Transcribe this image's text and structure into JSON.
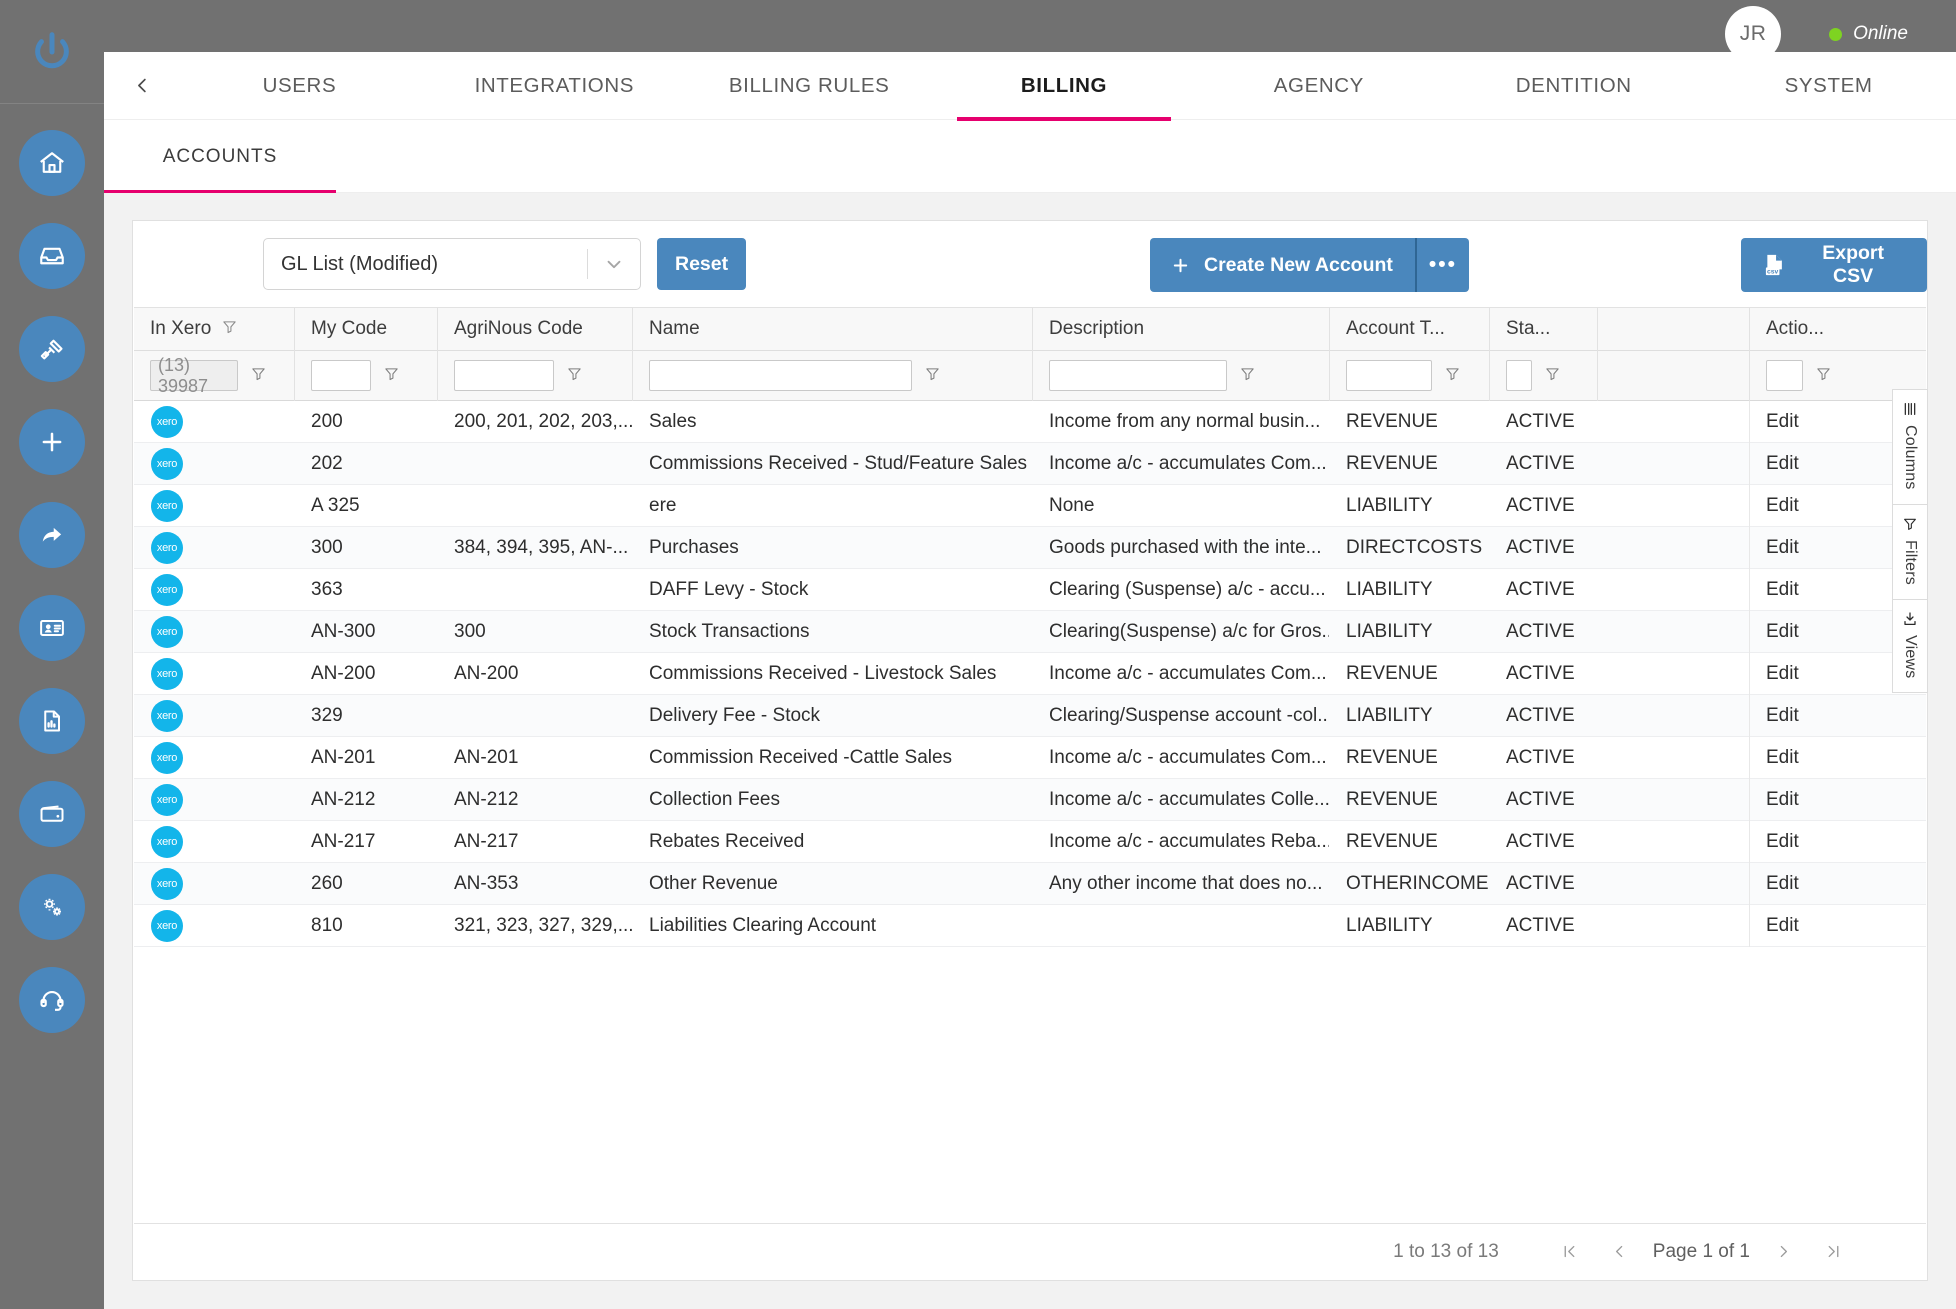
{
  "topbar": {
    "avatar_initials": "JR",
    "status_label": "Online",
    "status_color": "#7ed321"
  },
  "rail": {
    "logo_icon": "power-logo-icon",
    "items": [
      {
        "icon": "home-icon",
        "name": "home"
      },
      {
        "icon": "inbox-icon",
        "name": "inbox"
      },
      {
        "icon": "hammer-icon",
        "name": "auction"
      },
      {
        "icon": "plus-icon",
        "name": "create"
      },
      {
        "icon": "forward-icon",
        "name": "transfer"
      },
      {
        "icon": "contact-card-icon",
        "name": "contacts"
      },
      {
        "icon": "report-icon",
        "name": "reports"
      },
      {
        "icon": "wallet-icon",
        "name": "wallet"
      },
      {
        "icon": "gears-icon",
        "name": "settings"
      },
      {
        "icon": "headset-icon",
        "name": "support"
      }
    ]
  },
  "nav": {
    "back_icon": "chevron-left-icon",
    "tabs": [
      {
        "label": "USERS",
        "active": false
      },
      {
        "label": "INTEGRATIONS",
        "active": false
      },
      {
        "label": "BILLING RULES",
        "active": false
      },
      {
        "label": "BILLING",
        "active": true
      },
      {
        "label": "AGENCY",
        "active": false
      },
      {
        "label": "DENTITION",
        "active": false
      },
      {
        "label": "SYSTEM",
        "active": false
      }
    ],
    "subtabs": [
      {
        "label": "ACCOUNTS",
        "active": true
      }
    ],
    "accent_color": "#e6006e"
  },
  "toolbar": {
    "view_select_value": "GL List (Modified)",
    "view_select_caret_icon": "chevron-down-icon",
    "reset_label": "Reset",
    "create_label": "Create New Account",
    "create_plus_icon": "plus-icon",
    "create_more_label": "•••",
    "export_label": "Export CSV",
    "export_icon": "csv-file-icon",
    "primary_color": "#4a87bd"
  },
  "grid": {
    "columns": [
      {
        "key": "in_xero",
        "label": "In Xero",
        "has_filter_indicator": true,
        "filter_value": "(13) 39987",
        "filter_readonly": true,
        "input_width": 88
      },
      {
        "key": "my_code",
        "label": "My Code",
        "has_filter_indicator": false,
        "filter_value": "",
        "filter_readonly": false,
        "input_width": 60
      },
      {
        "key": "agrinous",
        "label": "AgriNous Code",
        "has_filter_indicator": false,
        "filter_value": "",
        "filter_readonly": false,
        "input_width": 100
      },
      {
        "key": "name",
        "label": "Name",
        "has_filter_indicator": false,
        "filter_value": "",
        "filter_readonly": false,
        "input_width": 263
      },
      {
        "key": "description",
        "label": "Description",
        "has_filter_indicator": false,
        "filter_value": "",
        "filter_readonly": false,
        "input_width": 178
      },
      {
        "key": "account_type",
        "label": "Account T...",
        "has_filter_indicator": false,
        "filter_value": "",
        "filter_readonly": false,
        "input_width": 86
      },
      {
        "key": "status",
        "label": "Sta...",
        "has_filter_indicator": false,
        "filter_value": "",
        "filter_readonly": false,
        "input_width": 26
      },
      {
        "key": "spacer",
        "label": "",
        "has_filter_indicator": false,
        "filter_value": null,
        "filter_readonly": false,
        "input_width": 0
      },
      {
        "key": "actions",
        "label": "Actio...",
        "has_filter_indicator": false,
        "filter_value": "",
        "filter_readonly": false,
        "input_width": 37
      }
    ],
    "xero_badge_label": "xero",
    "action_label": "Edit",
    "rows": [
      {
        "in_xero": true,
        "my_code": "200",
        "agrinous": "200, 201, 202, 203,...",
        "name": "Sales",
        "description": "Income from any normal busin...",
        "account_type": "REVENUE",
        "status": "ACTIVE"
      },
      {
        "in_xero": true,
        "my_code": "202",
        "agrinous": "",
        "name": "Commissions Received - Stud/Feature Sales",
        "description": "Income a/c - accumulates Com...",
        "account_type": "REVENUE",
        "status": "ACTIVE"
      },
      {
        "in_xero": true,
        "my_code": "A 325",
        "agrinous": "",
        "name": "ere",
        "description": "None",
        "account_type": "LIABILITY",
        "status": "ACTIVE"
      },
      {
        "in_xero": true,
        "my_code": "300",
        "agrinous": "384, 394, 395, AN-...",
        "name": "Purchases",
        "description": "Goods purchased with the inte...",
        "account_type": "DIRECTCOSTS",
        "status": "ACTIVE"
      },
      {
        "in_xero": true,
        "my_code": "363",
        "agrinous": "",
        "name": "DAFF Levy - Stock",
        "description": "Clearing (Suspense) a/c - accu...",
        "account_type": "LIABILITY",
        "status": "ACTIVE"
      },
      {
        "in_xero": true,
        "my_code": "AN-300",
        "agrinous": "300",
        "name": "Stock Transactions",
        "description": "Clearing(Suspense) a/c for Gros...",
        "account_type": "LIABILITY",
        "status": "ACTIVE"
      },
      {
        "in_xero": true,
        "my_code": "AN-200",
        "agrinous": "AN-200",
        "name": "Commissions Received - Livestock Sales",
        "description": "Income a/c - accumulates Com...",
        "account_type": "REVENUE",
        "status": "ACTIVE"
      },
      {
        "in_xero": true,
        "my_code": "329",
        "agrinous": "",
        "name": "Delivery Fee - Stock",
        "description": "Clearing/Suspense account -col...",
        "account_type": "LIABILITY",
        "status": "ACTIVE"
      },
      {
        "in_xero": true,
        "my_code": "AN-201",
        "agrinous": "AN-201",
        "name": "Commission Received -Cattle Sales",
        "description": "Income a/c - accumulates Com...",
        "account_type": "REVENUE",
        "status": "ACTIVE"
      },
      {
        "in_xero": true,
        "my_code": "AN-212",
        "agrinous": "AN-212",
        "name": "Collection Fees",
        "description": "Income a/c - accumulates Colle...",
        "account_type": "REVENUE",
        "status": "ACTIVE"
      },
      {
        "in_xero": true,
        "my_code": "AN-217",
        "agrinous": "AN-217",
        "name": "Rebates Received",
        "description": "Income a/c - accumulates Reba...",
        "account_type": "REVENUE",
        "status": "ACTIVE"
      },
      {
        "in_xero": true,
        "my_code": "260",
        "agrinous": "AN-353",
        "name": "Other Revenue",
        "description": "Any other income that does no...",
        "account_type": "OTHERINCOME",
        "status": "ACTIVE"
      },
      {
        "in_xero": true,
        "my_code": "810",
        "agrinous": "321, 323, 327, 329,...",
        "name": "Liabilities Clearing Account",
        "description": "",
        "account_type": "LIABILITY",
        "status": "ACTIVE"
      }
    ]
  },
  "footer": {
    "row_count": "1 to 13 of 13",
    "page_label": "Page 1 of 1",
    "first_icon": "first-page-icon",
    "prev_icon": "prev-page-icon",
    "next_icon": "next-page-icon",
    "last_icon": "last-page-icon"
  },
  "sidetools": [
    {
      "label": "Columns",
      "icon": "columns-icon"
    },
    {
      "label": "Filters",
      "icon": "funnel-icon"
    },
    {
      "label": "Views",
      "icon": "save-view-icon"
    }
  ]
}
